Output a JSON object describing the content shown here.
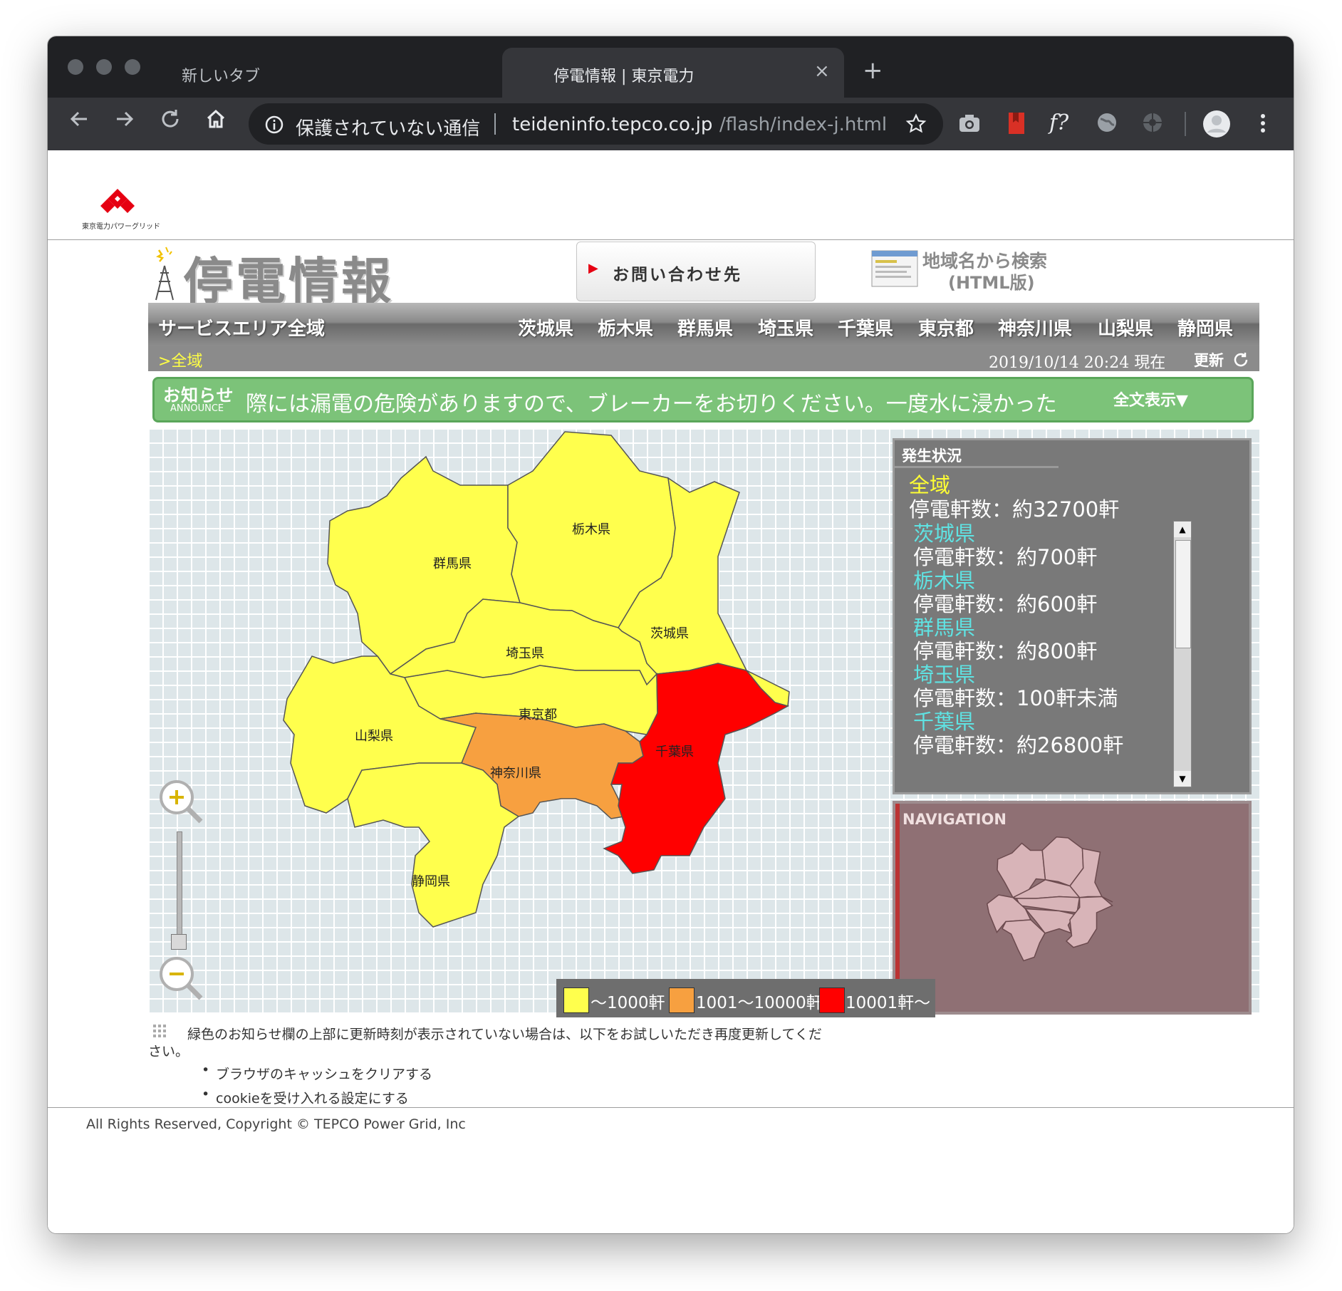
{
  "browser": {
    "tabs": [
      {
        "label": "新しいタブ",
        "close": "×"
      },
      {
        "label": "停電情報 | 東京電力",
        "close": "×"
      }
    ],
    "new_tab": "+",
    "security_text": "保護されていない通信",
    "url_host": "teideninfo.tepco.co.jp",
    "url_path": "/flash/index-j.html",
    "nav_icons": [
      "back-icon",
      "forward-icon",
      "reload-icon",
      "home-icon"
    ]
  },
  "page": {
    "logo_text": "東京電力パワーグリッド",
    "title": "停電情報",
    "contact_button": "お問い合わせ先",
    "area_search": {
      "line1": "地域名から検索",
      "line2": "(HTML版)"
    },
    "service_area": "サービスエリア全域",
    "prefectures": [
      "茨城県",
      "栃木県",
      "群馬県",
      "埼玉県",
      "千葉県",
      "東京都",
      "神奈川県",
      "山梨県",
      "静岡県"
    ],
    "breadcrumb": ">全域",
    "timestamp": "2019/10/14 20:24 現在",
    "refresh": "更新",
    "announce": {
      "label": "お知らせ",
      "label_en": "ANNOUNCE",
      "text": "際には漏電の危険がありますので、ブレーカーをお切りください。一度水に浸かった",
      "full_button": "全文表示▼"
    },
    "status": {
      "heading": "発生状況",
      "area": "全域",
      "total": "停電軒数：約32700軒",
      "items": [
        {
          "name": "茨城県",
          "value": "停電軒数：約700軒"
        },
        {
          "name": "栃木県",
          "value": "停電軒数：約600軒"
        },
        {
          "name": "群馬県",
          "value": "停電軒数：約800軒"
        },
        {
          "name": "埼玉県",
          "value": "停電軒数：100軒未満"
        },
        {
          "name": "千葉県",
          "value": "停電軒数：約26800軒"
        }
      ]
    },
    "navigation_label": "NAVIGATION",
    "map_labels": {
      "gunma": "群馬県",
      "tochigi": "栃木県",
      "ibaraki": "茨城県",
      "saitama": "埼玉県",
      "tokyo": "東京都",
      "yamanashi": "山梨県",
      "kanagawa": "神奈川県",
      "chiba": "千葉県",
      "shizuoka": "静岡県"
    },
    "legend": [
      {
        "label": "〜1000軒",
        "color": "#ffff4d"
      },
      {
        "label": "1001〜10000軒",
        "color": "#f7a040"
      },
      {
        "label": "10001軒〜",
        "color": "#ff0000"
      }
    ],
    "notes": {
      "line1": "緑色のお知らせ欄の上部に更新時刻が表示されていない場合は、以下をお試しいただき再度更新してくだ",
      "line2": "さい。",
      "bullet1": "ブラウザのキャッシュをクリアする",
      "bullet2": "cookieを受け入れる設定にする"
    },
    "copyright": "All Rights Reserved, Copyright © TEPCO Power Grid, Inc"
  },
  "colors": {
    "low": "#ffff4d",
    "mid": "#f7a040",
    "high": "#ff0000",
    "status_cyan": "#5fe3e3",
    "status_yellow": "#ffff33"
  }
}
